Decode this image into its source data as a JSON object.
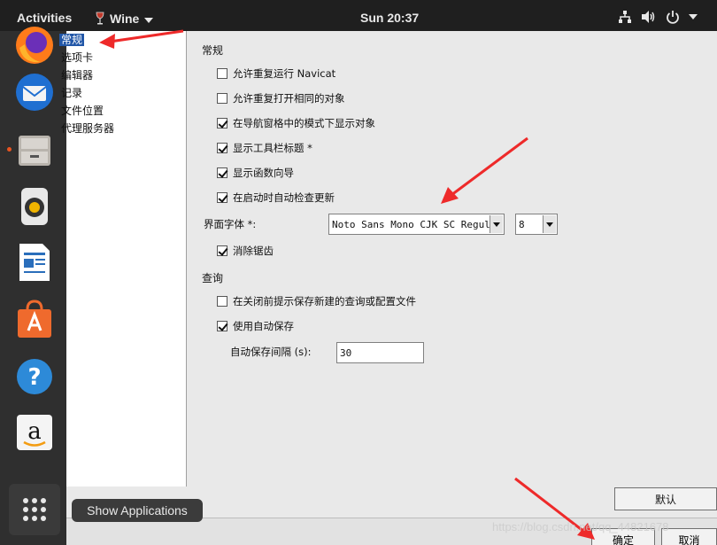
{
  "topbar": {
    "activities": "Activities",
    "app_name": "Wine",
    "clock": "Sun 20:37",
    "tray_icons": [
      "network-icon",
      "volume-icon",
      "power-icon"
    ]
  },
  "dock": {
    "items": [
      "firefox-icon",
      "thunderbird-icon",
      "files-icon",
      "rhythmbox-icon",
      "libreoffice-writer-icon",
      "software-center-icon",
      "help-icon",
      "amazon-icon"
    ],
    "show_applications_tooltip": "Show Applications"
  },
  "nav": {
    "items": [
      {
        "label": "常规",
        "selected": true
      },
      {
        "label": "选项卡",
        "selected": false
      },
      {
        "label": "编辑器",
        "selected": false
      },
      {
        "label": "记录",
        "selected": false
      },
      {
        "label": "文件位置",
        "selected": false
      },
      {
        "label": "代理服务器",
        "selected": false
      }
    ]
  },
  "general": {
    "section_title": "常规",
    "options": [
      {
        "label": "允许重复运行 Navicat",
        "checked": false
      },
      {
        "label": "允许重复打开相同的对象",
        "checked": false
      },
      {
        "label": "在导航窗格中的模式下显示对象",
        "checked": true
      },
      {
        "label": "显示工具栏标题 *",
        "checked": true
      },
      {
        "label": "显示函数向导",
        "checked": true
      },
      {
        "label": "在启动时自动检查更新",
        "checked": true
      }
    ],
    "font_label": "界面字体 *:",
    "font_value": "Noto Sans Mono CJK SC Regular",
    "font_size_value": "8",
    "antialias": {
      "label": "消除锯齿",
      "checked": true
    }
  },
  "query": {
    "section_title": "查询",
    "options": [
      {
        "label": "在关闭前提示保存新建的查询或配置文件",
        "checked": false
      },
      {
        "label": "使用自动保存",
        "checked": true
      }
    ],
    "autosave_label": "自动保存间隔 (s):",
    "autosave_value": "30"
  },
  "buttons": {
    "default": "默认",
    "ok": "确定",
    "cancel": "取消"
  },
  "watermark": "https://blog.csdn.net/qq_44821678"
}
